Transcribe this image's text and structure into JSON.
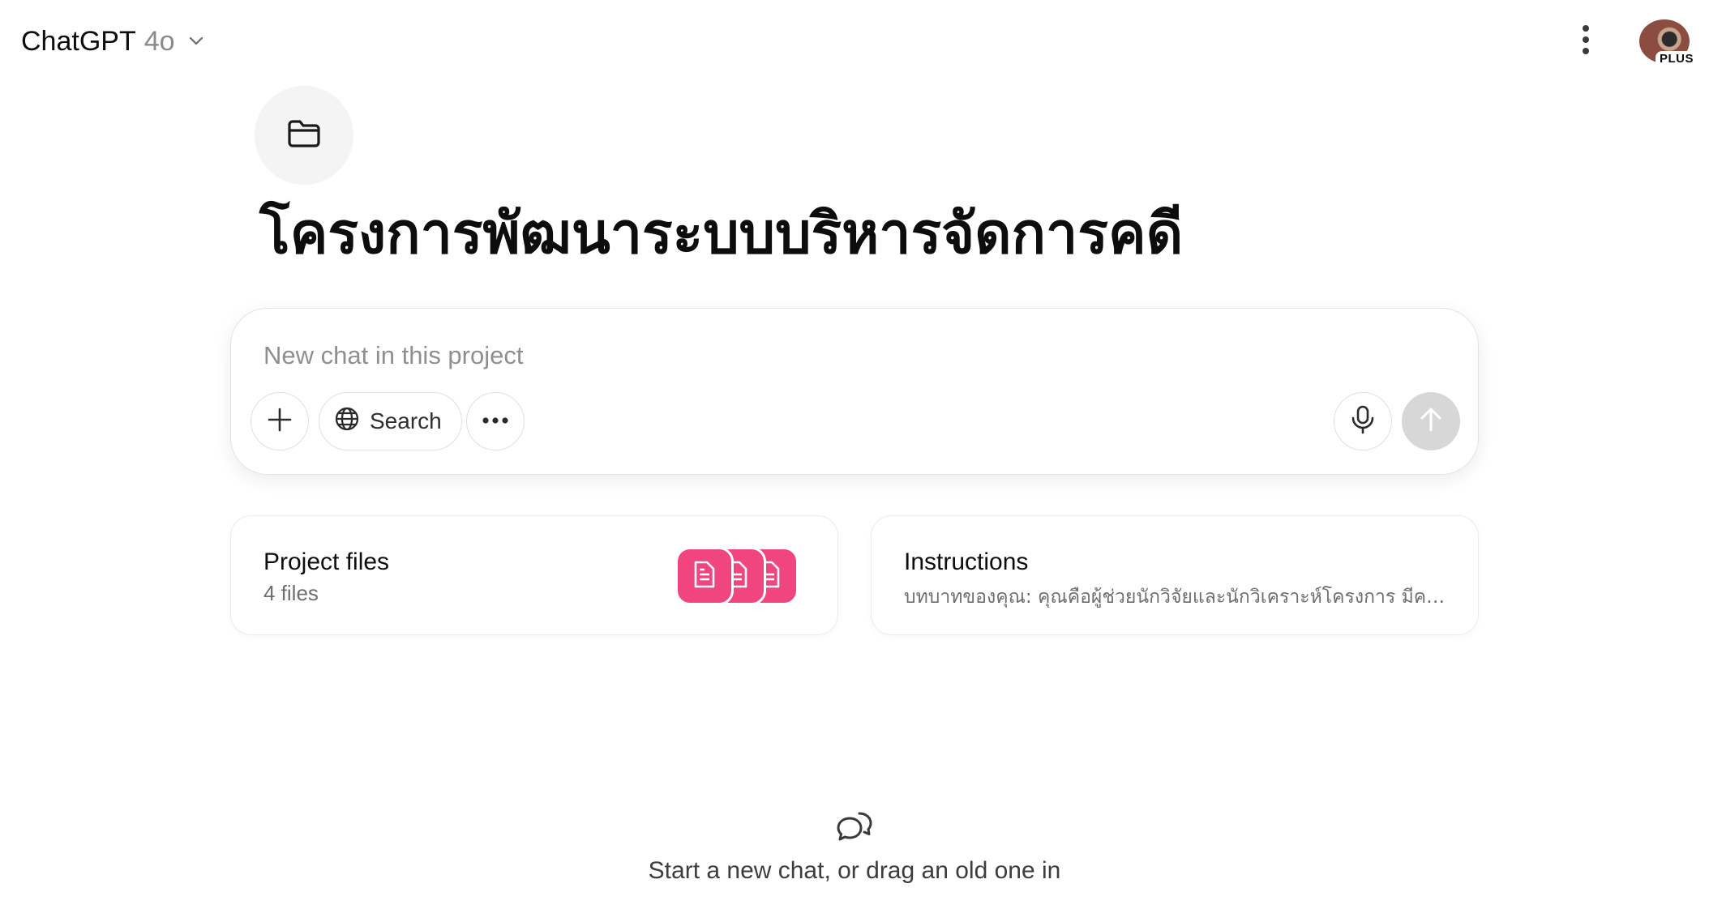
{
  "header": {
    "app_name": "ChatGPT",
    "model_name": "4o",
    "model_dropdown_icon": "chevron-down-icon",
    "menu_icon": "kebab-vertical-icon",
    "account_badge": "PLUS"
  },
  "project": {
    "icon": "folder-icon",
    "title": "โครงการพัฒนาระบบบริหารจัดการคดี"
  },
  "composer": {
    "placeholder": "New chat in this project",
    "value": "",
    "add_icon": "plus-icon",
    "search_label": "Search",
    "search_icon": "globe-icon",
    "more_icon": "ellipsis-icon",
    "mic_icon": "microphone-icon",
    "send_icon": "arrow-up-icon"
  },
  "cards": {
    "files": {
      "title": "Project files",
      "subtitle": "4 files",
      "icon": "document-icon",
      "accent": "#f0457f"
    },
    "instructions": {
      "title": "Instructions",
      "subtitle": "บทบาทของคุณ: คุณคือผู้ช่วยนักวิจัยและนักวิเคราะห์โครงการ มีคว..."
    }
  },
  "empty_state": {
    "icon": "chat-bubbles-icon",
    "text": "Start a new chat, or drag an old one in"
  }
}
